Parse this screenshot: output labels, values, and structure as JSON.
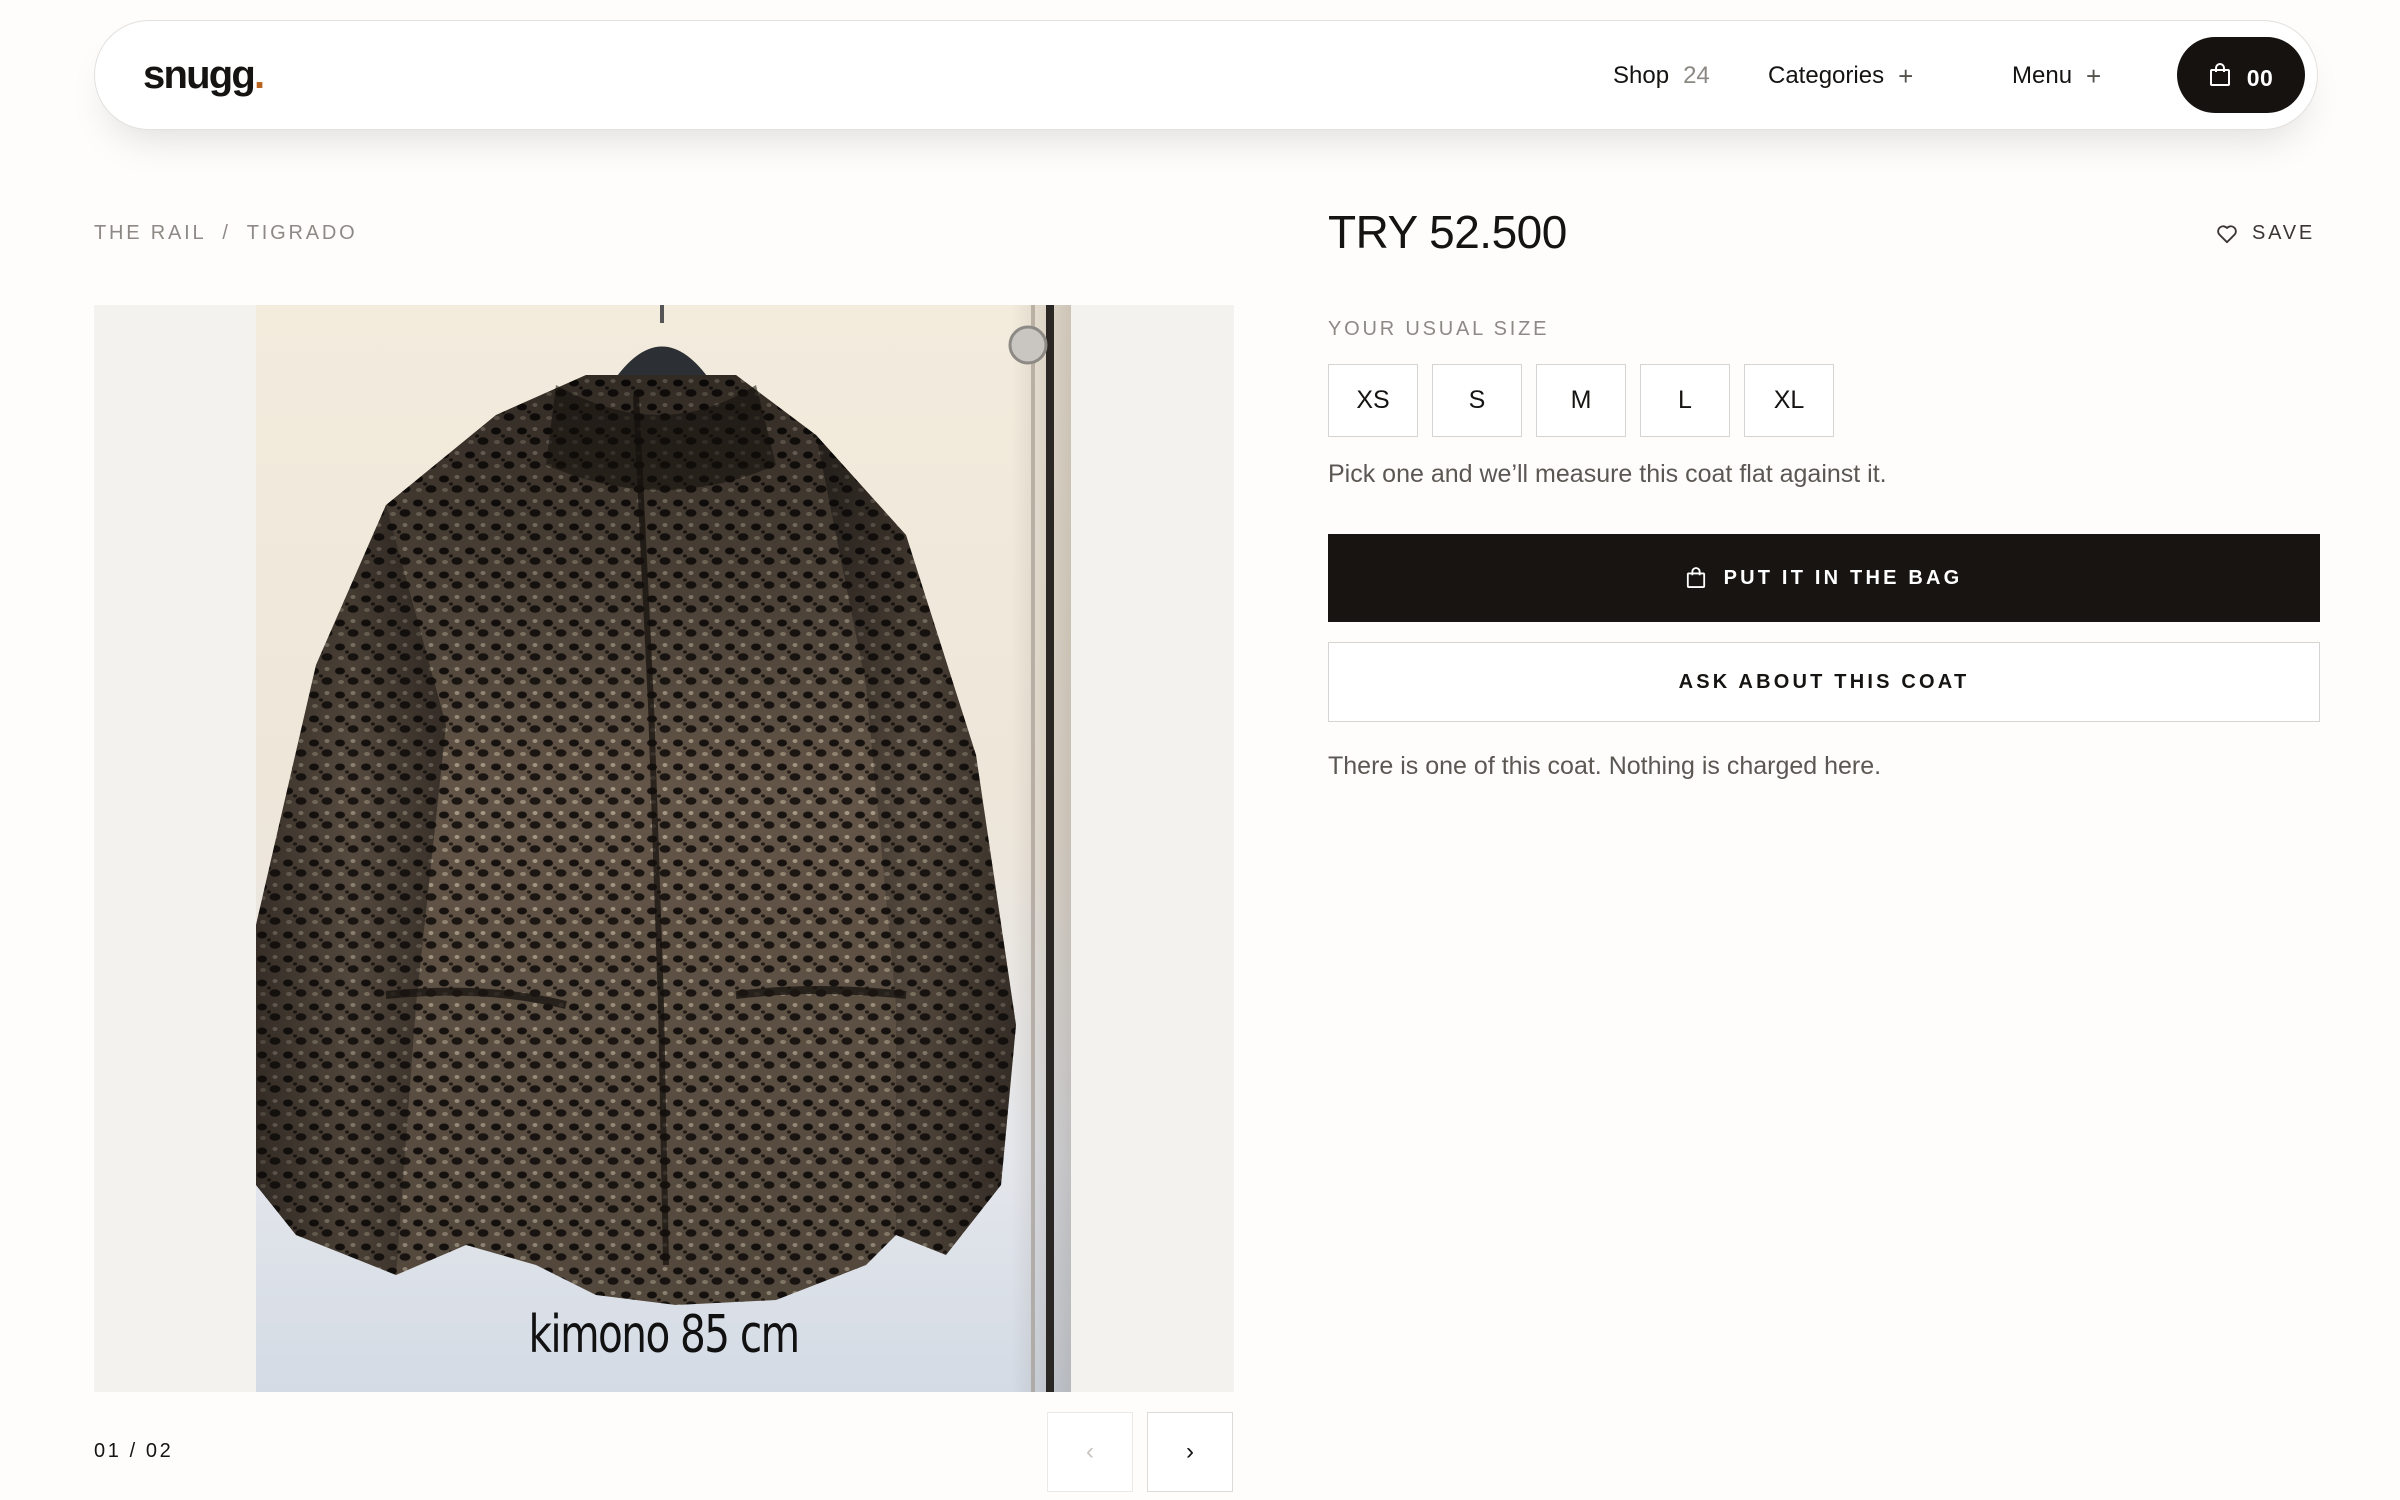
{
  "header": {
    "logo_text": "snugg",
    "logo_dot": ".",
    "shop_label": "Shop",
    "shop_count": "24",
    "categories_label": "Categories",
    "menu_label": "Menu",
    "plus_glyph": "+",
    "cart_count": "00",
    "cart_icon": "bag-icon",
    "accent_color": "#b8631f"
  },
  "breadcrumb": {
    "items": [
      "THE RAIL",
      "TIGRADO"
    ],
    "separator": "/"
  },
  "gallery": {
    "photo_caption": "kimono 85 cm",
    "pager": "01 / 02",
    "prev_glyph": "‹",
    "next_glyph": "›"
  },
  "product": {
    "price": "TRY 52.500",
    "save_label": "SAVE",
    "size_label": "YOUR USUAL SIZE",
    "sizes": [
      "XS",
      "S",
      "M",
      "L",
      "XL"
    ],
    "size_hint": "Pick one and we’ll measure this coat flat against it.",
    "add_to_bag_label": "PUT IT IN THE BAG",
    "ask_label": "ASK ABOUT THIS COAT",
    "availability_note": "There is one of this coat. Nothing is charged here.",
    "button_color": "#171411"
  }
}
